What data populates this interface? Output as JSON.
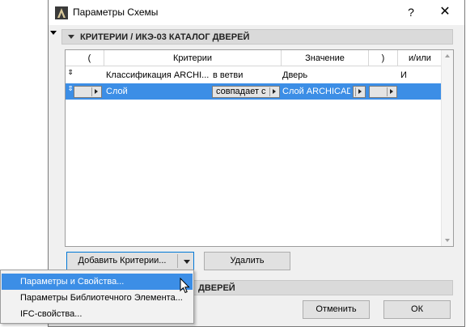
{
  "window": {
    "title": "Параметры Схемы",
    "help_glyph": "?",
    "close_glyph": "✕"
  },
  "section1": {
    "label": "КРИТЕРИИ / ИКЭ-03 КАТАЛОГ ДВЕРЕЙ"
  },
  "section2": {
    "label_visible": "ДВЕРЕЙ"
  },
  "table": {
    "headers": [
      "(",
      "Критерии",
      "Значение",
      ")",
      "и/или"
    ],
    "rows": [
      {
        "handle": "⇕",
        "open": "",
        "criterion": "Классификация ARCHI...",
        "operator": "в ветви",
        "value": "Дверь",
        "close": "",
        "andor": "И",
        "selected": false
      },
      {
        "handle": "⇕",
        "open": "",
        "criterion": "Слой",
        "operator": "совпадает с",
        "value": "Слой ARCHICAD",
        "close": "",
        "andor": "",
        "selected": true
      }
    ]
  },
  "buttons": {
    "add": "Добавить Критерии...",
    "delete": "Удалить",
    "cancel": "Отменить",
    "ok": "ОК"
  },
  "popup_menu": {
    "items": [
      {
        "label": "Параметры и Свойства...",
        "highlighted": true
      },
      {
        "label": "Параметры Библиотечного Элемента...",
        "highlighted": false
      },
      {
        "label": "IFC-свойства...",
        "highlighted": false
      }
    ]
  },
  "colors": {
    "selection": "#3c8ee6",
    "section_bg": "#dadada",
    "dialog_bg": "#f0f0f0"
  }
}
